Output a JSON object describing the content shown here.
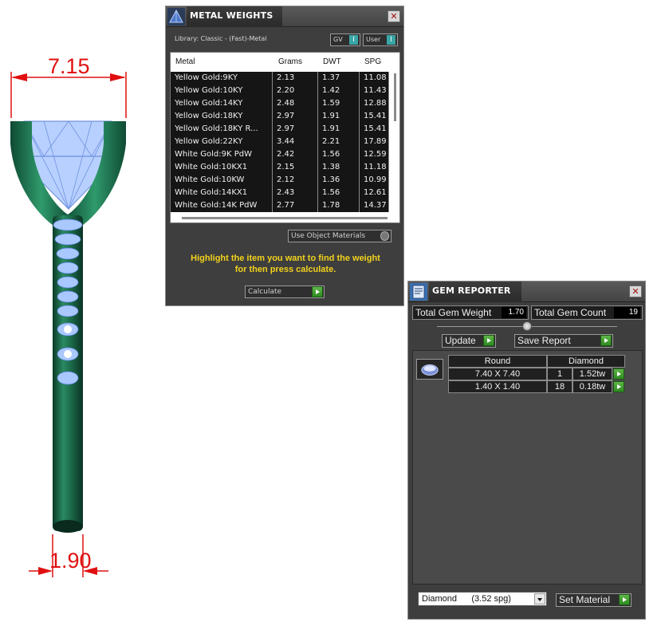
{
  "ring": {
    "top_dimension": "7.15",
    "bottom_dimension": "1.90"
  },
  "metal_weights": {
    "title": "METAL WEIGHTS",
    "library": "Library: Classic - (Fast)-Metal",
    "gv_label": "GV",
    "user_label": "User",
    "toggle_indicator": "I",
    "columns": [
      "Metal",
      "Grams",
      "DWT",
      "SPG"
    ],
    "rows": [
      {
        "metal": "Yellow Gold:9KY",
        "grams": "2.13",
        "dwt": "1.37",
        "spg": "11.08"
      },
      {
        "metal": "Yellow Gold:10KY",
        "grams": "2.20",
        "dwt": "1.42",
        "spg": "11.43"
      },
      {
        "metal": "Yellow Gold:14KY",
        "grams": "2.48",
        "dwt": "1.59",
        "spg": "12.88"
      },
      {
        "metal": "Yellow Gold:18KY",
        "grams": "2.97",
        "dwt": "1.91",
        "spg": "15.41"
      },
      {
        "metal": "Yellow Gold:18KY R...",
        "grams": "2.97",
        "dwt": "1.91",
        "spg": "15.41"
      },
      {
        "metal": "Yellow Gold:22KY",
        "grams": "3.44",
        "dwt": "2.21",
        "spg": "17.89"
      },
      {
        "metal": "White Gold:9K PdW",
        "grams": "2.42",
        "dwt": "1.56",
        "spg": "12.59"
      },
      {
        "metal": "White Gold:10KX1",
        "grams": "2.15",
        "dwt": "1.38",
        "spg": "11.18"
      },
      {
        "metal": "White Gold:10KW",
        "grams": "2.12",
        "dwt": "1.36",
        "spg": "10.99"
      },
      {
        "metal": "White Gold:14KX1",
        "grams": "2.43",
        "dwt": "1.56",
        "spg": "12.61"
      },
      {
        "metal": "White Gold:14K PdW",
        "grams": "2.77",
        "dwt": "1.78",
        "spg": "14.37"
      }
    ],
    "use_object_materials": "Use Object Materials",
    "instructions_line1": "Highlight the item you want to find the weight",
    "instructions_line2": "for then press calculate.",
    "calculate_label": "Calculate"
  },
  "gem_reporter": {
    "title": "GEM REPORTER",
    "total_weight_label": "Total Gem Weight",
    "total_weight_value": "1.70",
    "total_count_label": "Total Gem Count",
    "total_count_value": "19",
    "update_label": "Update",
    "save_report_label": "Save Report",
    "columns": [
      "Round",
      "Diamond"
    ],
    "rows": [
      {
        "size": "7.40 X 7.40",
        "count": "1",
        "tw": "1.52tw"
      },
      {
        "size": "1.40 X 1.40",
        "count": "18",
        "tw": "0.18tw"
      }
    ],
    "material_selected": "Diamond      (3.52 spg)",
    "set_material_label": "Set Material"
  },
  "colors": {
    "metal": "#1c6b4a",
    "gem": "#a9c8ff",
    "dimension": "#e01010",
    "panel_bg": "#3e3e3e",
    "highlight_text": "#f2d21c"
  },
  "icons": {
    "metal_weights_app": "pyramid-icon",
    "gem_reporter_app": "gem-report-icon",
    "close": "close-icon",
    "play": "play-arrow-icon"
  }
}
